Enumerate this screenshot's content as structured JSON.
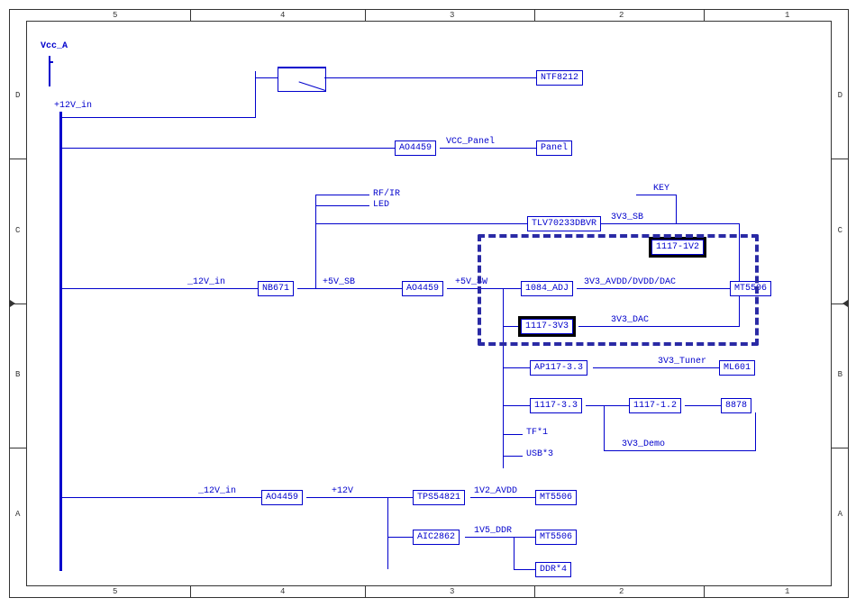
{
  "ruler": {
    "columns": [
      "5",
      "4",
      "3",
      "2",
      "1"
    ],
    "rows": [
      "D",
      "C",
      "B",
      "A"
    ]
  },
  "power_rails": {
    "vcc_a": "Vcc_A",
    "p12v_in": "+12V_in"
  },
  "net_labels": {
    "rf_ir": "RF/IR",
    "led": "LED",
    "p12v_in_mid": "_12V_in",
    "p5v_sb": "+5V_SB",
    "p5v_sw": "+5V_SW",
    "key": "KEY",
    "t3v3_sb": "3V3_SB",
    "t3v3_avdd_dvdd_dac": "3V3_AVDD/DVDD/DAC",
    "t3v3_dac": "3V3_DAC",
    "t3v3_tuner": "3V3_Tuner",
    "t3v3_demo": "3V3_Demo",
    "vcc_panel": "VCC_Panel",
    "tf1": "TF*1",
    "usb3": "USB*3",
    "p12v_in_bot": "_12V_in",
    "p12v": "+12V",
    "t1v2_avdd": "1V2_AVDD",
    "t1v5_ddr": "1V5_DDR"
  },
  "blocks": {
    "ntf8212": "NTF8212",
    "ao4459_a": "AO4459",
    "panel": "Panel",
    "nb671": "NB671",
    "ao4459_b": "AO4459",
    "tlv70233": "TLV70233DBVR",
    "b1117_1v2": "1117-1V2",
    "b1084_adj": "1084_ADJ",
    "b1117_3v3": "1117-3V3",
    "mt5506_a": "MT5506",
    "ap117_33": "AP117-3.3",
    "ml601": "ML601",
    "b1117_33": "1117-3.3",
    "b1117_12": "1117-1.2",
    "b8878": "8878",
    "ao4459_c": "AO4459",
    "tps54821": "TPS54821",
    "mt5506_b": "MT5506",
    "aic2862": "AIC2862",
    "mt5506_c": "MT5506",
    "ddr4": "DDR*4"
  }
}
